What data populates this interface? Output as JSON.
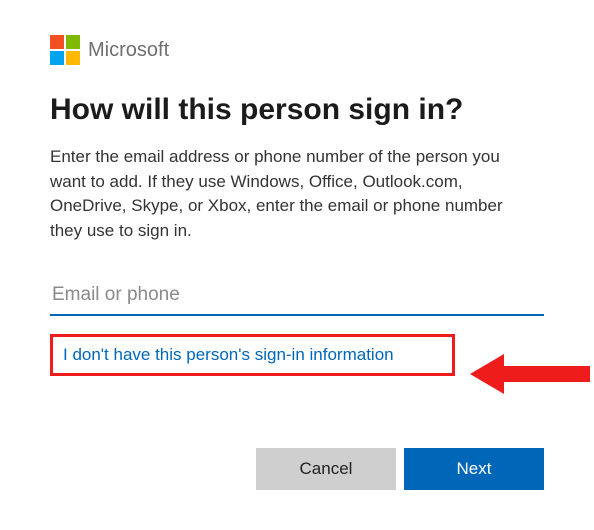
{
  "brand": {
    "name": "Microsoft",
    "colors": {
      "tl": "#f25022",
      "tr": "#7fba00",
      "bl": "#00a4ef",
      "br": "#ffb900"
    }
  },
  "heading": "How will this person sign in?",
  "description": "Enter the email address or phone number of the person you want to add. If they use Windows, Office, Outlook.com, OneDrive, Skype, or Xbox, enter the email or phone number they use to sign in.",
  "input": {
    "placeholder": "Email or phone",
    "value": ""
  },
  "link": {
    "label": "I don't have this person's sign-in information"
  },
  "buttons": {
    "cancel": "Cancel",
    "next": "Next"
  },
  "annotation": {
    "highlight_color": "#ef1c1c"
  }
}
